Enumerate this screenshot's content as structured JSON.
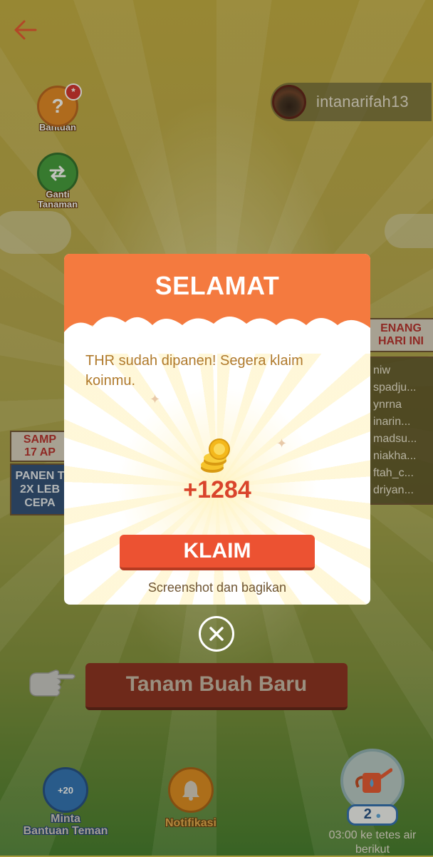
{
  "header": {
    "back_icon": "back-arrow-icon",
    "username": "intanarifah13"
  },
  "side": {
    "help_label": "Bantuan",
    "help_badge": "*",
    "swap_label_1": "Ganti",
    "swap_label_2": "Tanaman"
  },
  "background_sign": {
    "top_lines": [
      "SAMP",
      "17 AP"
    ],
    "body_lines": [
      "PANEN T",
      "2X LEB",
      "CEPA"
    ]
  },
  "leaderboard": {
    "title_lines": [
      "ENANG",
      "HARI INI"
    ],
    "entries": [
      "niw",
      "spadju...",
      "ynrna",
      "inarin...",
      "madsu...",
      "niakha...",
      "ftah_c...",
      "driyan..."
    ]
  },
  "actions": {
    "plant_new_label": "Tanam Buah Baru"
  },
  "bottom": {
    "help_friends_badge": "+20",
    "help_friends_label_1": "Minta",
    "help_friends_label_2": "Bantuan Teman",
    "notif_label": "Notifikasi",
    "water_count": "2",
    "water_note_1": "03:00 ke tetes air",
    "water_note_2": "berikut"
  },
  "modal": {
    "title": "SELAMAT",
    "message": "THR sudah dipanen! Segera klaim koinmu.",
    "amount": "+1284",
    "claim_label": "KLAIM",
    "share_label": "Screenshot dan bagikan"
  },
  "colors": {
    "modal_header": "#f47a3f",
    "claim_button": "#ec5232",
    "amount": "#d9442b",
    "message": "#b07a2c"
  }
}
